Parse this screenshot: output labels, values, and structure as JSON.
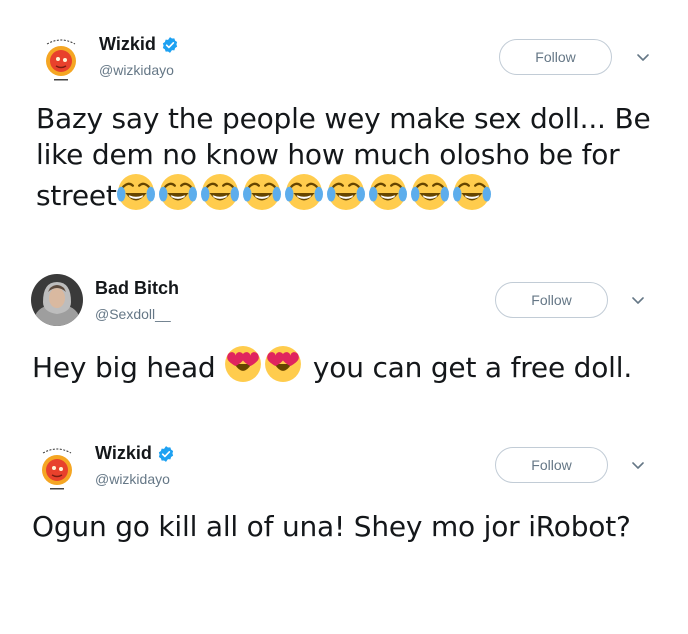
{
  "tweets": [
    {
      "name": "Wizkid",
      "handle": "@wizkidayo",
      "verified": true,
      "follow_label": "Follow",
      "text_lines": [
        "Bazy say the people wey make sex doll... Be",
        "like dem no know how much olosho be for",
        "street"
      ],
      "emojis_after": [
        "face-with-tears-of-joy",
        "face-with-tears-of-joy",
        "face-with-tears-of-joy",
        "face-with-tears-of-joy",
        "face-with-tears-of-joy",
        "face-with-tears-of-joy",
        "face-with-tears-of-joy",
        "face-with-tears-of-joy",
        "face-with-tears-of-joy"
      ]
    },
    {
      "name": "Bad Bitch",
      "handle": "@Sexdoll__",
      "verified": false,
      "follow_label": "Follow",
      "text_before": "Hey big head",
      "emojis_middle": [
        "smiling-face-with-heart-eyes",
        "smiling-face-with-heart-eyes"
      ],
      "text_after": "you can get a free doll."
    },
    {
      "name": "Wizkid",
      "handle": "@wizkidayo",
      "verified": true,
      "follow_label": "Follow",
      "text": "Ogun go kill all of una! Shey mo jor iRobot?"
    }
  ],
  "colors": {
    "verified_blue": "#1da1f2",
    "muted_text": "#657786",
    "button_border": "#c2ccd6",
    "emoji_yellow": "#ffcc4d",
    "heart_red": "#e0245e"
  }
}
